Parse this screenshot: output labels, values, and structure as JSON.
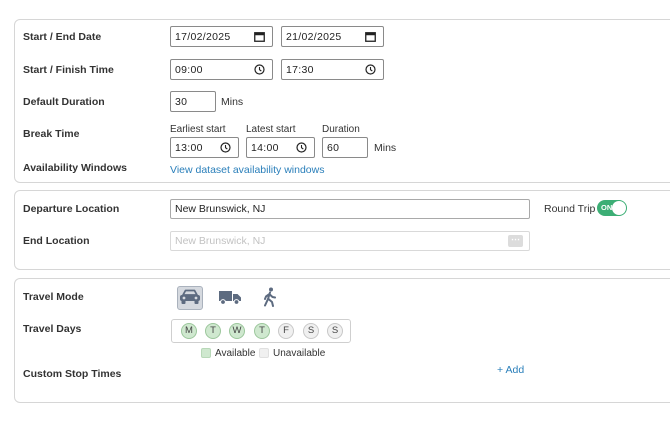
{
  "schedule": {
    "start_end_label": "Start / End Date",
    "start_date": "17/02/2025",
    "end_date": "21/02/2025",
    "start_finish_label": "Start / Finish Time",
    "start_time": "09:00",
    "finish_time": "17:30",
    "default_duration_label": "Default Duration",
    "default_duration_value": "30",
    "default_duration_unit": "Mins",
    "break_label": "Break Time",
    "earliest_start_label": "Earliest start",
    "earliest_start_value": "13:00",
    "latest_start_label": "Latest start",
    "latest_start_value": "14:00",
    "duration_label": "Duration",
    "duration_value": "60",
    "duration_unit": "Mins",
    "availability_label": "Availability Windows",
    "availability_link": "View dataset availability windows"
  },
  "locations": {
    "departure_label": "Departure Location",
    "departure_value": "New Brunswick, NJ",
    "round_trip_label": "Round Trip",
    "round_trip_state": "ON",
    "end_label": "End Location",
    "end_value": "New Brunswick, NJ",
    "end_more": "⋯"
  },
  "travel": {
    "mode_label": "Travel Mode",
    "modes": [
      "car-icon",
      "truck-icon",
      "walk-icon"
    ],
    "active_mode": "car",
    "days_label": "Travel Days",
    "days": [
      {
        "letter": "M",
        "on": true
      },
      {
        "letter": "T",
        "on": true
      },
      {
        "letter": "W",
        "on": true
      },
      {
        "letter": "T",
        "on": true
      },
      {
        "letter": "F",
        "on": false
      },
      {
        "letter": "S",
        "on": false
      },
      {
        "letter": "S",
        "on": false
      }
    ],
    "legend_available": "Available",
    "legend_unavailable": "Unavailable",
    "custom_stop_label": "Custom Stop Times",
    "add_link": "+ Add"
  },
  "colors": {
    "accent_green": "#3cae75",
    "link_blue": "#2a7fba",
    "available": "#cfe8cf",
    "unavailable": "#f0f0f0"
  }
}
